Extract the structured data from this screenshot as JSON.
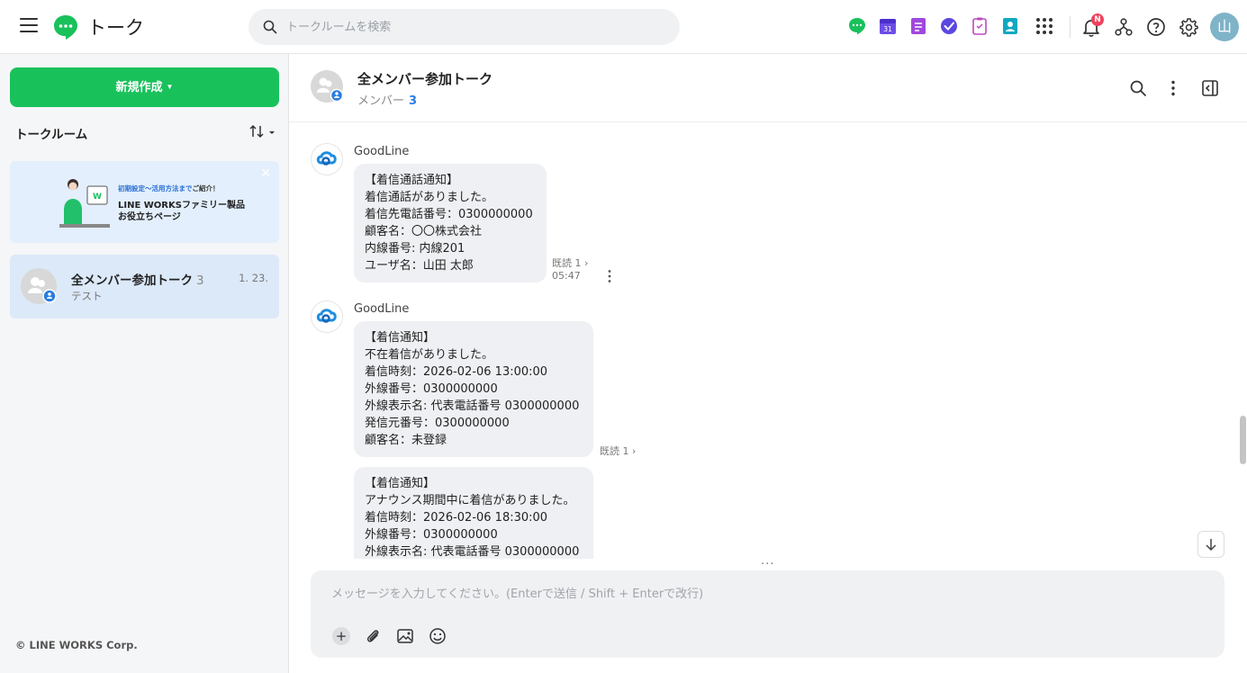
{
  "topbar": {
    "title": "トーク",
    "search_placeholder": "トークルームを検索",
    "notification_badge": "N",
    "user_avatar_initial": "山",
    "app_icons": [
      "talk-icon",
      "calendar-icon",
      "note-icon",
      "task-icon",
      "form-icon",
      "contacts-icon"
    ],
    "calendar_day": "31"
  },
  "sidebar": {
    "new_button_label": "新規作成",
    "rooms_label": "トークルーム",
    "banner": {
      "line1_a": "初期設定〜活用方法まで",
      "line1_b": "ご紹介！",
      "line2": "LINE WORKSファミリー製品",
      "line3": "お役立ちページ"
    },
    "rooms": [
      {
        "name": "全メンバー参加トーク",
        "count": "3",
        "preview": "テスト",
        "date": "1. 23."
      }
    ],
    "copyright": "© LINE WORKS Corp."
  },
  "chat": {
    "title": "全メンバー参加トーク",
    "members_label": "メンバー",
    "members_count": "3",
    "messages": [
      {
        "sender": "GoodLine",
        "text": "【着信通話通知】\n着信通話がありました。\n着信先電話番号：0300000000\n顧客名：〇〇株式会社\n内線番号: 内線201\nユーザ名：山田 太郎",
        "read": "既読 1 ›",
        "time": "05:47"
      },
      {
        "sender": "GoodLine",
        "text": "【着信通知】\n不在着信がありました。\n着信時刻：2026-02-06 13:00:00\n外線番号：0300000000\n外線表示名: 代表電話番号 0300000000\n発信元番号：0300000000\n顧客名：未登録",
        "read": "既読 1 ›"
      },
      {
        "text": "【着信通知】\nアナウンス期間中に着信がありました。\n着信時刻：2026-02-06 18:30:00\n外線番号：0300000000\n外線表示名: 代表電話番号 0300000000"
      }
    ]
  },
  "composer": {
    "placeholder": "メッセージを入力してください。(Enterで送信 / Shift + Enterで改行)"
  },
  "colors": {
    "brand_green": "#19c15b",
    "accent_blue": "#2a7de1",
    "selected_room": "#dce9f9",
    "badge_red": "#f0435a"
  }
}
